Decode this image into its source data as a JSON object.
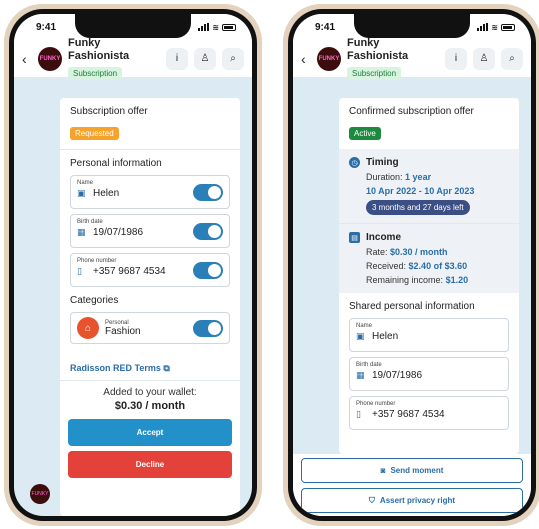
{
  "status": {
    "time": "9:41"
  },
  "header": {
    "title": "Funky Fashionista",
    "tag": "Subscription",
    "logo_text": "FUNKY"
  },
  "left": {
    "offer_title": "Subscription offer",
    "offer_status": "Requested",
    "personal_title": "Personal information",
    "fields": [
      {
        "label": "Name",
        "value": "Helen"
      },
      {
        "label": "Birth date",
        "value": "19/07/1986"
      },
      {
        "label": "Phone number",
        "value": "+357 9687 4534"
      }
    ],
    "categories_title": "Categories",
    "category": {
      "label": "Personal",
      "value": "Fashion"
    },
    "terms_link": "Radisson RED Terms",
    "wallet_label": "Added to your wallet:",
    "wallet_amount": "$0.30 / month",
    "accept": "Accept",
    "decline": "Decline"
  },
  "right": {
    "offer_title": "Confirmed subscription offer",
    "offer_status": "Active",
    "timing_title": "Timing",
    "duration_label": "Duration:",
    "duration_value": "1 year",
    "date_range": "10 Apr 2022 - 10 Apr 2023",
    "time_left": "3 months and 27 days left",
    "income_title": "Income",
    "rate_label": "Rate:",
    "rate_value": "$0.30 / month",
    "received_label": "Received:",
    "received_value": "$2.40 of $3.60",
    "remaining_label": "Remaining income:",
    "remaining_value": "$1.20",
    "shared_title": "Shared personal information",
    "fields": [
      {
        "label": "Name",
        "value": "Helen"
      },
      {
        "label": "Birth date",
        "value": "19/07/1986"
      },
      {
        "label": "Phone number",
        "value": "+357 9687 4534"
      }
    ],
    "send_moment": "Send moment",
    "assert_privacy": "Assert privacy right"
  }
}
